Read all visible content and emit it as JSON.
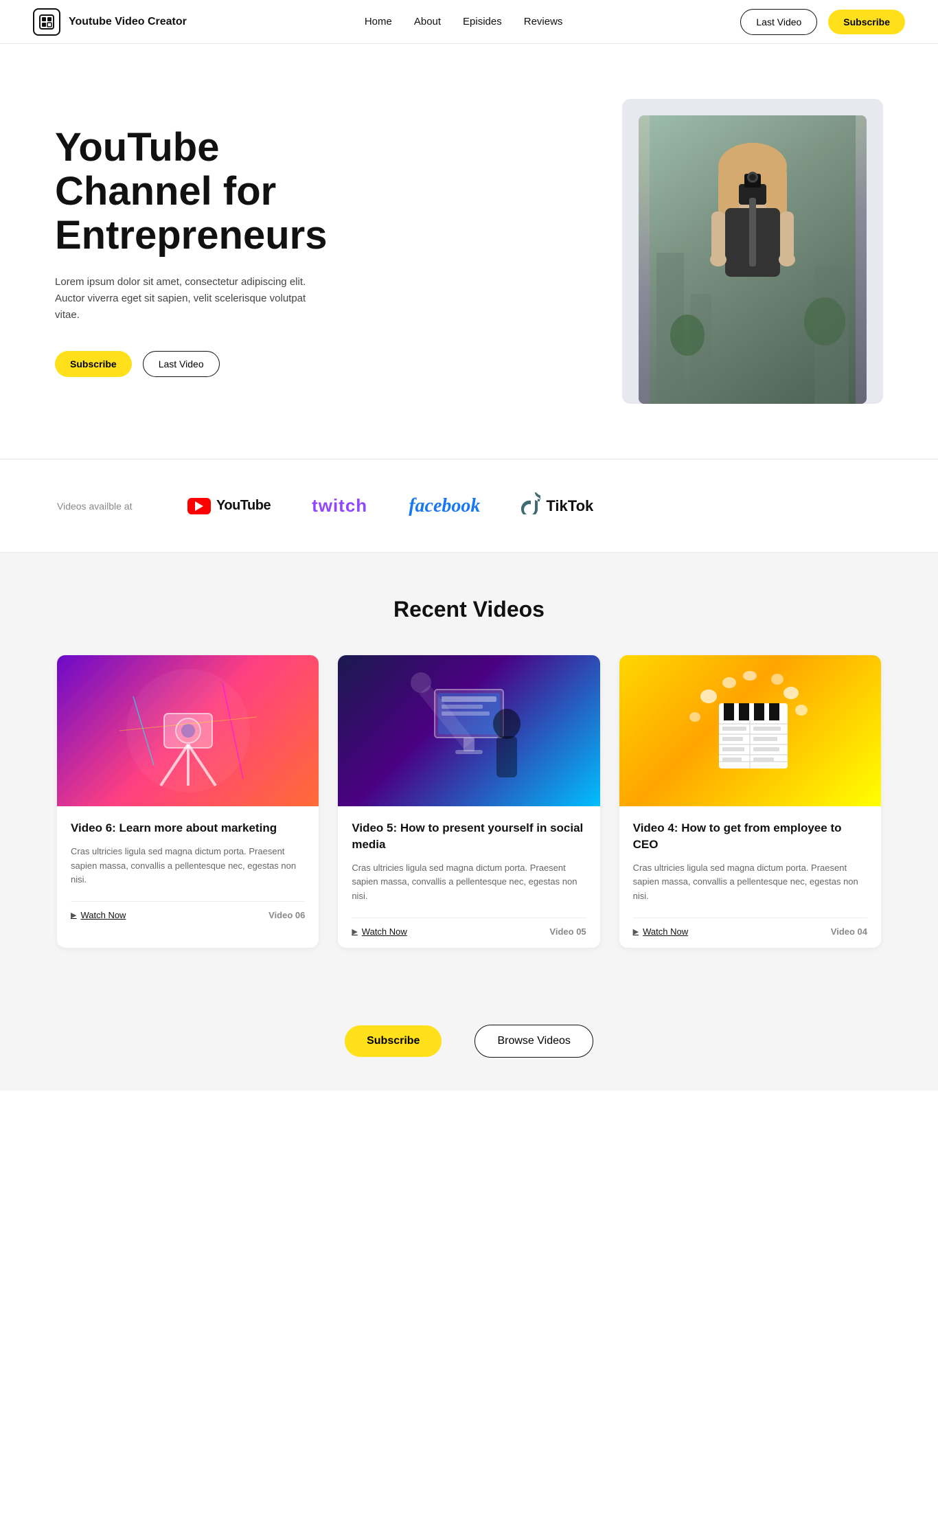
{
  "site": {
    "logo_icon": "▣",
    "logo_text": "Youtube Video Creator"
  },
  "nav": {
    "links": [
      {
        "id": "home",
        "label": "Home"
      },
      {
        "id": "about",
        "label": "About"
      },
      {
        "id": "episodes",
        "label": "Episides"
      },
      {
        "id": "reviews",
        "label": "Reviews"
      }
    ],
    "last_video_label": "Last Video",
    "subscribe_label": "Subscribe"
  },
  "hero": {
    "title": "YouTube Channel for Entrepreneurs",
    "description": "Lorem ipsum dolor sit amet, consectetur adipiscing elit. Auctor viverra eget sit sapien, velit scelerisque volutpat vitae.",
    "subscribe_label": "Subscribe",
    "last_video_label": "Last Video"
  },
  "platforms": {
    "label": "Videos availble at",
    "items": [
      {
        "id": "youtube",
        "name": "YouTube"
      },
      {
        "id": "twitch",
        "name": "twitch"
      },
      {
        "id": "facebook",
        "name": "facebook"
      },
      {
        "id": "tiktok",
        "name": "TikTok"
      }
    ]
  },
  "recent_videos": {
    "section_title": "Recent Videos",
    "videos": [
      {
        "id": "video6",
        "title": "Video 6: Learn more about marketing",
        "description": "Cras ultricies ligula sed magna dictum porta. Praesent sapien massa, convallis a pellentesque nec, egestas non nisi.",
        "watch_label": "Watch Now",
        "number_label": "Video 06",
        "thumb_type": "camera"
      },
      {
        "id": "video5",
        "title": "Video 5: How to present yourself in social media",
        "description": "Cras ultricies ligula sed magna dictum porta. Praesent sapien massa, convallis a pellentesque nec, egestas non nisi.",
        "watch_label": "Watch Now",
        "number_label": "Video 05",
        "thumb_type": "studio"
      },
      {
        "id": "video4",
        "title": "Video 4: How to get from employee to CEO",
        "description": "Cras ultricies ligula sed magna dictum porta. Praesent sapien massa, convallis a pellentesque nec, egestas non nisi.",
        "watch_label": "Watch Now",
        "number_label": "Video 04",
        "thumb_type": "clapper"
      }
    ]
  },
  "bottom_cta": {
    "subscribe_label": "Subscribe",
    "browse_label": "Browse Videos"
  }
}
